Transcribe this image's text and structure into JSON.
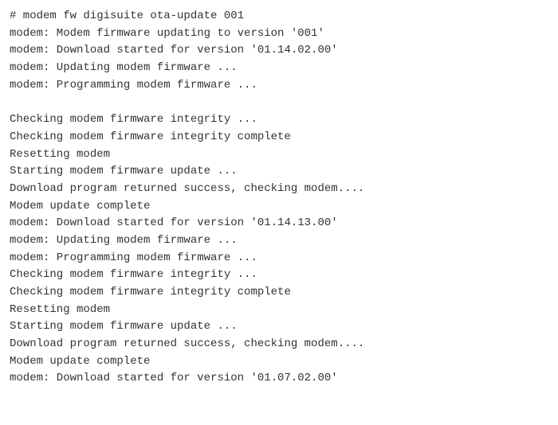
{
  "terminal": {
    "lines": [
      "# modem fw digisuite ota-update 001",
      "modem: Modem firmware updating to version '001'",
      "modem: Download started for version '01.14.02.00'",
      "modem: Updating modem firmware ...",
      "modem: Programming modem firmware ...",
      "",
      "Checking modem firmware integrity ...",
      "Checking modem firmware integrity complete",
      "Resetting modem",
      "Starting modem firmware update ...",
      "Download program returned success, checking modem....",
      "Modem update complete",
      "modem: Download started for version '01.14.13.00'",
      "modem: Updating modem firmware ...",
      "modem: Programming modem firmware ...",
      "Checking modem firmware integrity ...",
      "Checking modem firmware integrity complete",
      "Resetting modem",
      "Starting modem firmware update ...",
      "Download program returned success, checking modem....",
      "Modem update complete",
      "modem: Download started for version '01.07.02.00'"
    ]
  }
}
